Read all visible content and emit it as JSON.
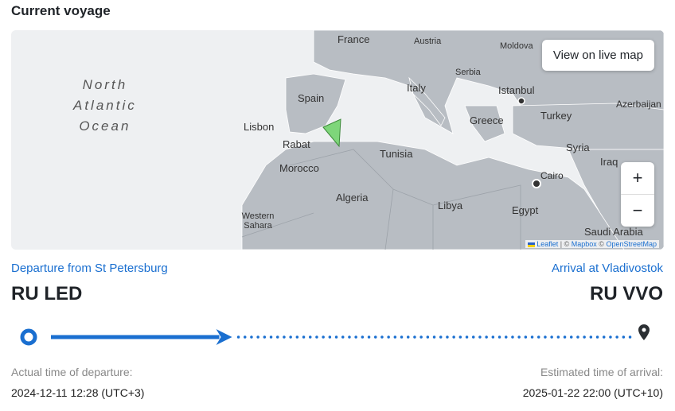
{
  "section_title": "Current voyage",
  "map": {
    "ocean_label": [
      "North",
      "Atlantic",
      "Ocean"
    ],
    "labels": [
      "France",
      "Austria",
      "Moldova",
      "Spain",
      "Italy",
      "Serbia",
      "Istanbul",
      "Lisbon",
      "Greece",
      "Turkey",
      "Azerbaijan",
      "Rabat",
      "Tunisia",
      "Syria",
      "Iraq",
      "Morocco",
      "Cairo",
      "Algeria",
      "Libya",
      "Egypt",
      "Western Sahara",
      "Saudi Arabia"
    ],
    "view_live_label": "View on live map",
    "zoom_in": "+",
    "zoom_out": "−",
    "attribution": {
      "leaflet": "Leaflet",
      "sep": "| ©",
      "mapbox": "Mapbox",
      "sep2": "©",
      "osm": "OpenStreetMap"
    },
    "colors": {
      "land": "#b8bdc3",
      "sea": "#eef0f2",
      "vessel": "#7ed67a"
    }
  },
  "departure": {
    "label": "Departure from St Petersburg",
    "code": "RU LED",
    "time_label": "Actual time of departure:",
    "time": "2024-12-11 12:28 (UTC+3)"
  },
  "arrival": {
    "label": "Arrival at Vladivostok",
    "code": "RU VVO",
    "time_label": "Estimated time of arrival:",
    "time": "2025-01-22 22:00 (UTC+10)"
  },
  "progress": {
    "fraction": 0.31,
    "color": "#1a6fd0"
  }
}
